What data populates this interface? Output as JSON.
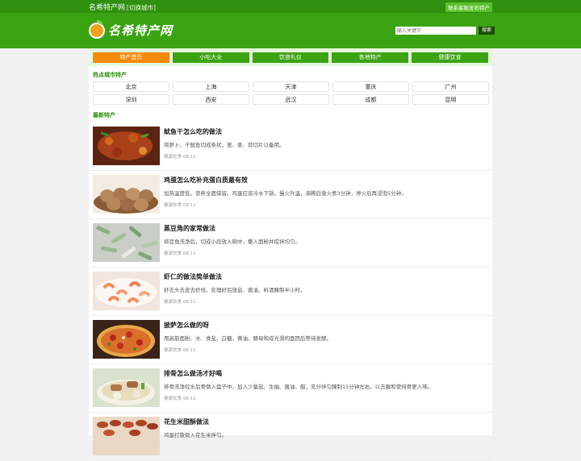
{
  "topbar": {
    "site_name": "名希特产网",
    "switch_city": "[切换城市]",
    "contact": "联系客服发布特产"
  },
  "header": {
    "logo_text": "名希特产网",
    "search_placeholder": "输入关键字",
    "search_button": "搜索"
  },
  "nav": [
    {
      "label": "特产首页",
      "active": true
    },
    {
      "label": "小吃大全"
    },
    {
      "label": "饮食礼仪"
    },
    {
      "label": "各地特产"
    },
    {
      "label": "健康饮食"
    }
  ],
  "hot_cities": {
    "title": "热点城市特产",
    "cities": [
      "北京",
      "上海",
      "天津",
      "重庆",
      "广州",
      "深圳",
      "西安",
      "武汉",
      "成都",
      "昆明"
    ]
  },
  "latest": {
    "title": "最新特产",
    "articles": [
      {
        "title": "鱿鱼干怎么吃的做法",
        "desc": "将萝卜、干鱿鱼切成条状，葱、姜、蒜切片以备用。",
        "meta": "健康饮食 08-11",
        "image": "squid-dish"
      },
      {
        "title": "鸡蛋怎么吃补充蛋白质最有效",
        "desc": "加热温度低，营养全面保留。鸡蛋应该冷水下锅，慢火升温，沸腾后微火煮3分钟，停火后再浸泡5分钟。",
        "meta": "健康饮食 08-11",
        "image": "eggs"
      },
      {
        "title": "蒸豆角的家常做法",
        "desc": "将豆角洗净后，切成小段放入碗中，撒入面粉并搅拌均匀。",
        "meta": "健康饮食 08-11",
        "image": "green-beans"
      },
      {
        "title": "虾仁的做法简单做法",
        "desc": "虾去头去皮去虾线，处理好后放盐、酱油、料酒腌制半小时。",
        "meta": "健康饮食 08-11",
        "image": "shrimp"
      },
      {
        "title": "披萨怎么做的呀",
        "desc": "用高筋面粉、水、食盐、白糖、黄油、酵母和成光滑的面团后等待发酵。",
        "meta": "健康饮食 08-11",
        "image": "pizza"
      },
      {
        "title": "排骨怎么做汤才好喝",
        "desc": "排骨洗净控水后骨倒入盘子中，加入少量盐、生抽、酱油、醋，充分拌匀腌制15分钟左右，以去腥和使排骨更入味。",
        "meta": "健康饮食 08-11",
        "image": "rib-soup"
      },
      {
        "title": "花生米甜酥做法",
        "desc": "鸡蛋打散倒入花生米拌匀。",
        "meta": "",
        "image": "peanuts"
      }
    ]
  },
  "colors": {
    "topbar": "#2f8f0f",
    "header": "#3aa312",
    "nav_active": "#f58a0b",
    "accent_text": "#2f8f0f"
  }
}
